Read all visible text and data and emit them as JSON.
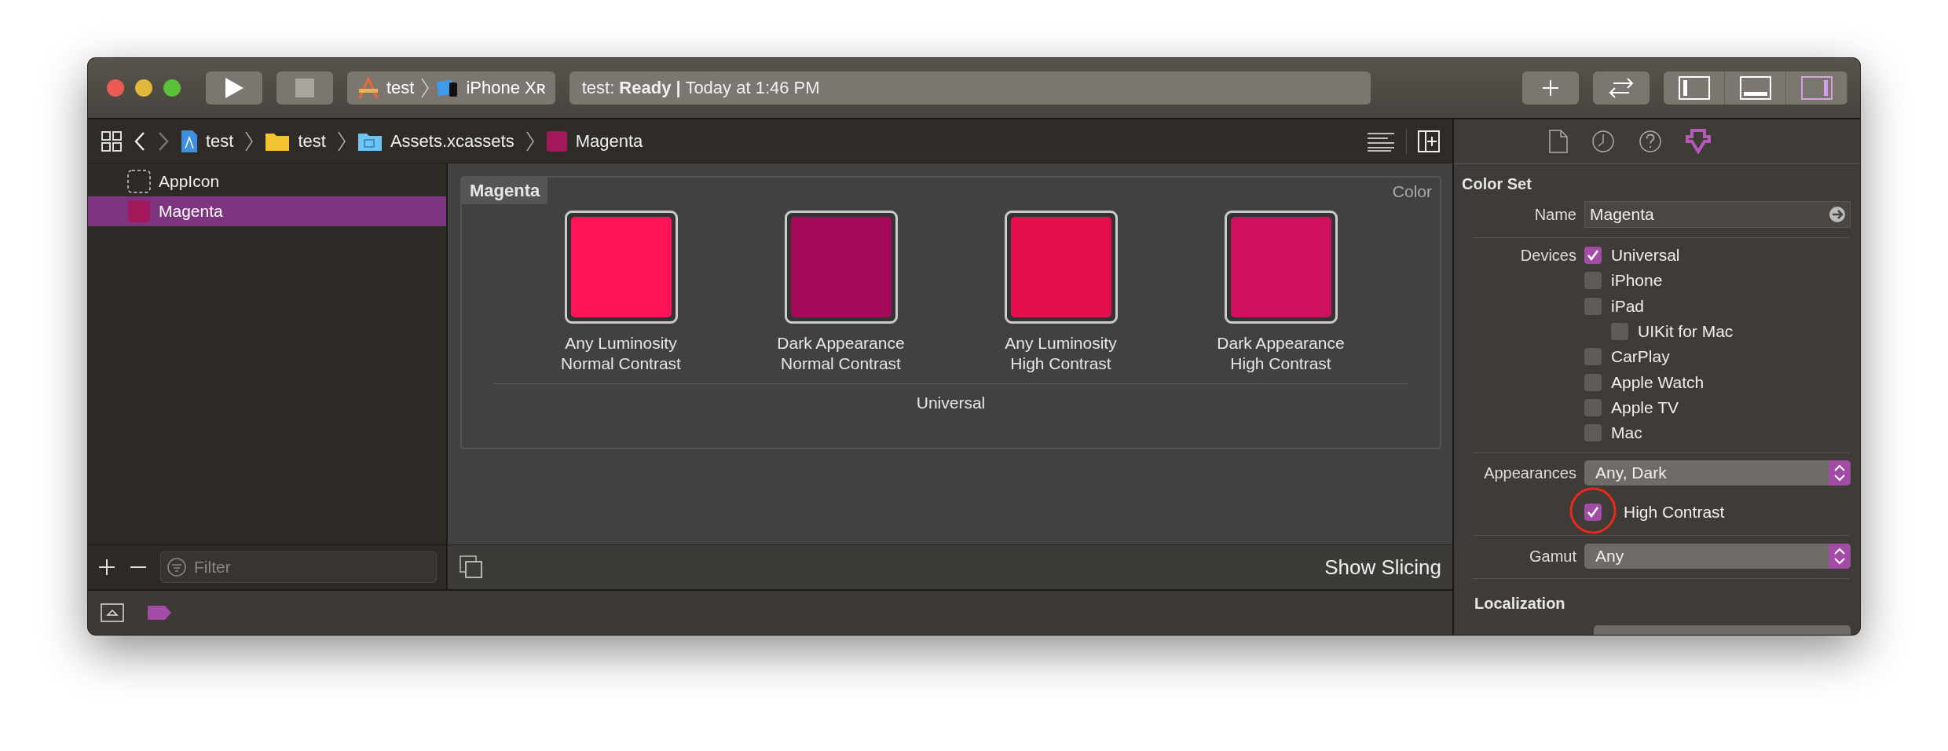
{
  "toolbar": {
    "scheme": {
      "project": "test",
      "device": "iPhone Xʀ"
    },
    "status": "test: **Ready |** Today at 1:46 PM",
    "panels": [
      {
        "kind": "navigator",
        "selected": false
      },
      {
        "kind": "debug",
        "selected": false
      },
      {
        "kind": "inspector",
        "selected": true
      }
    ]
  },
  "breadcrumb": [
    {
      "label": "test",
      "kind": "project"
    },
    {
      "label": "test",
      "kind": "folder"
    },
    {
      "label": "Assets.xcassets",
      "kind": "assets"
    },
    {
      "label": "Magenta",
      "kind": "colorset"
    }
  ],
  "sidebar": {
    "items": [
      {
        "label": "AppIcon",
        "kind": "appicon",
        "selected": false
      },
      {
        "label": "Magenta",
        "kind": "colorset",
        "selected": true
      }
    ],
    "filter": {
      "placeholder": "Filter"
    }
  },
  "asset": {
    "title": "Magenta",
    "type_label": "Color",
    "swatches": [
      {
        "lines": [
          "Any Luminosity",
          "Normal Contrast"
        ],
        "color": "#ff1458"
      },
      {
        "lines": [
          "Dark Appearance",
          "Normal Contrast"
        ],
        "color": "#a50a5a"
      },
      {
        "lines": [
          "Any Luminosity",
          "High Contrast"
        ],
        "color": "#e30f4e"
      },
      {
        "lines": [
          "Dark Appearance",
          "High Contrast"
        ],
        "color": "#cf1060"
      }
    ],
    "group_label": "Universal",
    "show_slicing": "Show Slicing"
  },
  "inspector": {
    "tabs": [
      {
        "kind": "file",
        "selected": false
      },
      {
        "kind": "history",
        "selected": false
      },
      {
        "kind": "help",
        "selected": false
      },
      {
        "kind": "attributes",
        "selected": true
      }
    ],
    "section": "Color Set",
    "name": {
      "label": "Name",
      "value": "Magenta"
    },
    "devices_label": "Devices",
    "devices": [
      {
        "label": "Universal",
        "checked": true
      },
      {
        "label": "iPhone",
        "checked": false
      },
      {
        "label": "iPad",
        "checked": false,
        "children": [
          {
            "label": "UIKit for Mac",
            "checked": false
          }
        ]
      },
      {
        "label": "CarPlay",
        "checked": false
      },
      {
        "label": "Apple Watch",
        "checked": false
      },
      {
        "label": "Apple TV",
        "checked": false
      },
      {
        "label": "Mac",
        "checked": false
      }
    ],
    "appearances": {
      "label": "Appearances",
      "value": "Any, Dark"
    },
    "high_contrast": {
      "label": "High Contrast",
      "checked": true
    },
    "gamut": {
      "label": "Gamut",
      "value": "Any"
    },
    "localization": "Localization"
  }
}
